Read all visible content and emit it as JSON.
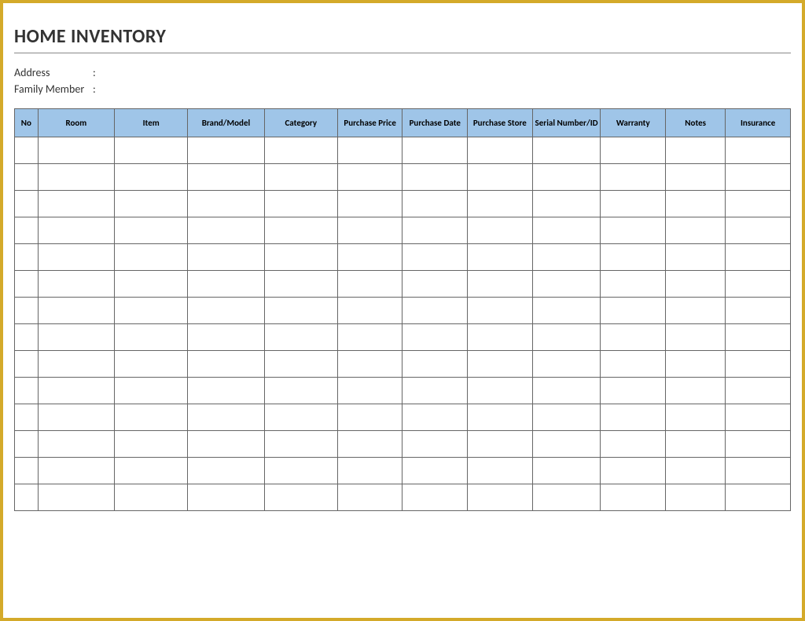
{
  "title": "HOME INVENTORY",
  "info": {
    "address_label": "Address",
    "address_value": "",
    "family_label": "Family Member",
    "family_value": ""
  },
  "columns": {
    "no": "No",
    "room": "Room",
    "item": "Item",
    "brand": "Brand/Model",
    "category": "Category",
    "price": "Purchase Price",
    "date": "Purchase Date",
    "store": "Purchase Store",
    "serial": "Serial Number/ID",
    "warranty": "Warranty",
    "notes": "Notes",
    "insurance": "Insurance"
  },
  "rows": [
    {
      "no": "",
      "room": "",
      "item": "",
      "brand": "",
      "category": "",
      "price": "",
      "date": "",
      "store": "",
      "serial": "",
      "warranty": "",
      "notes": "",
      "insurance": ""
    },
    {
      "no": "",
      "room": "",
      "item": "",
      "brand": "",
      "category": "",
      "price": "",
      "date": "",
      "store": "",
      "serial": "",
      "warranty": "",
      "notes": "",
      "insurance": ""
    },
    {
      "no": "",
      "room": "",
      "item": "",
      "brand": "",
      "category": "",
      "price": "",
      "date": "",
      "store": "",
      "serial": "",
      "warranty": "",
      "notes": "",
      "insurance": ""
    },
    {
      "no": "",
      "room": "",
      "item": "",
      "brand": "",
      "category": "",
      "price": "",
      "date": "",
      "store": "",
      "serial": "",
      "warranty": "",
      "notes": "",
      "insurance": ""
    },
    {
      "no": "",
      "room": "",
      "item": "",
      "brand": "",
      "category": "",
      "price": "",
      "date": "",
      "store": "",
      "serial": "",
      "warranty": "",
      "notes": "",
      "insurance": ""
    },
    {
      "no": "",
      "room": "",
      "item": "",
      "brand": "",
      "category": "",
      "price": "",
      "date": "",
      "store": "",
      "serial": "",
      "warranty": "",
      "notes": "",
      "insurance": ""
    },
    {
      "no": "",
      "room": "",
      "item": "",
      "brand": "",
      "category": "",
      "price": "",
      "date": "",
      "store": "",
      "serial": "",
      "warranty": "",
      "notes": "",
      "insurance": ""
    },
    {
      "no": "",
      "room": "",
      "item": "",
      "brand": "",
      "category": "",
      "price": "",
      "date": "",
      "store": "",
      "serial": "",
      "warranty": "",
      "notes": "",
      "insurance": ""
    },
    {
      "no": "",
      "room": "",
      "item": "",
      "brand": "",
      "category": "",
      "price": "",
      "date": "",
      "store": "",
      "serial": "",
      "warranty": "",
      "notes": "",
      "insurance": ""
    },
    {
      "no": "",
      "room": "",
      "item": "",
      "brand": "",
      "category": "",
      "price": "",
      "date": "",
      "store": "",
      "serial": "",
      "warranty": "",
      "notes": "",
      "insurance": ""
    },
    {
      "no": "",
      "room": "",
      "item": "",
      "brand": "",
      "category": "",
      "price": "",
      "date": "",
      "store": "",
      "serial": "",
      "warranty": "",
      "notes": "",
      "insurance": ""
    },
    {
      "no": "",
      "room": "",
      "item": "",
      "brand": "",
      "category": "",
      "price": "",
      "date": "",
      "store": "",
      "serial": "",
      "warranty": "",
      "notes": "",
      "insurance": ""
    },
    {
      "no": "",
      "room": "",
      "item": "",
      "brand": "",
      "category": "",
      "price": "",
      "date": "",
      "store": "",
      "serial": "",
      "warranty": "",
      "notes": "",
      "insurance": ""
    },
    {
      "no": "",
      "room": "",
      "item": "",
      "brand": "",
      "category": "",
      "price": "",
      "date": "",
      "store": "",
      "serial": "",
      "warranty": "",
      "notes": "",
      "insurance": ""
    }
  ]
}
